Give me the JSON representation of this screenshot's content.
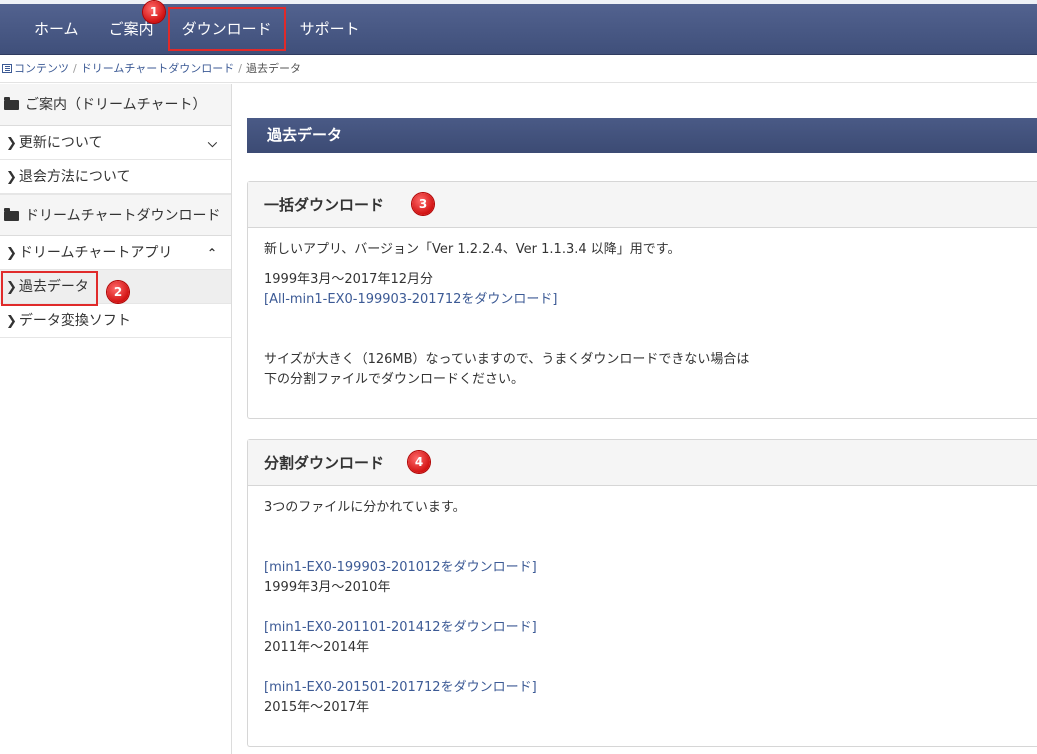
{
  "nav": {
    "items": [
      {
        "label": "ホーム"
      },
      {
        "label": "ご案内"
      },
      {
        "label": "ダウンロード"
      },
      {
        "label": "サポート"
      }
    ]
  },
  "breadcrumb": {
    "items": [
      "コンテンツ",
      "ドリームチャートダウンロード",
      "過去データ"
    ],
    "separator": "/"
  },
  "sidebar": {
    "sections": [
      {
        "title": "ご案内（ドリームチャート）",
        "items": [
          {
            "label": "更新について",
            "toggle": "⌄"
          },
          {
            "label": "退会方法について"
          }
        ]
      },
      {
        "title": "ドリームチャートダウンロード",
        "items": [
          {
            "label": "ドリームチャートアプリ",
            "toggle": "⌃"
          },
          {
            "label": "過去データ"
          },
          {
            "label": "データ変換ソフト"
          }
        ]
      }
    ]
  },
  "badges": [
    "1",
    "2",
    "3",
    "4"
  ],
  "content": {
    "page_title": "過去データ",
    "bulk": {
      "title": "一括ダウンロード",
      "desc": "新しいアプリ、バージョン「Ver 1.2.2.4、Ver 1.1.3.4 以降」用です。",
      "period": "1999年3月～2017年12月分",
      "link": "[All-min1-EX0-199903-201712をダウンロード]",
      "note1": "サイズが大きく（126MB）なっていますので、うまくダウンロードできない場合は",
      "note2": "下の分割ファイルでダウンロードください。"
    },
    "split": {
      "title": "分割ダウンロード",
      "desc": "3つのファイルに分かれています。",
      "files": [
        {
          "link": "[min1-EX0-199903-201012をダウンロード]",
          "period": "1999年3月～2010年"
        },
        {
          "link": "[min1-EX0-201101-201412をダウンロード]",
          "period": "2011年～2014年"
        },
        {
          "link": "[min1-EX0-201501-201712をダウンロード]",
          "period": "2015年～2017年"
        }
      ]
    }
  },
  "colors": {
    "nav_bg": "#4a5a86",
    "accent_red": "#e02a2a",
    "link": "#3c5a95"
  }
}
